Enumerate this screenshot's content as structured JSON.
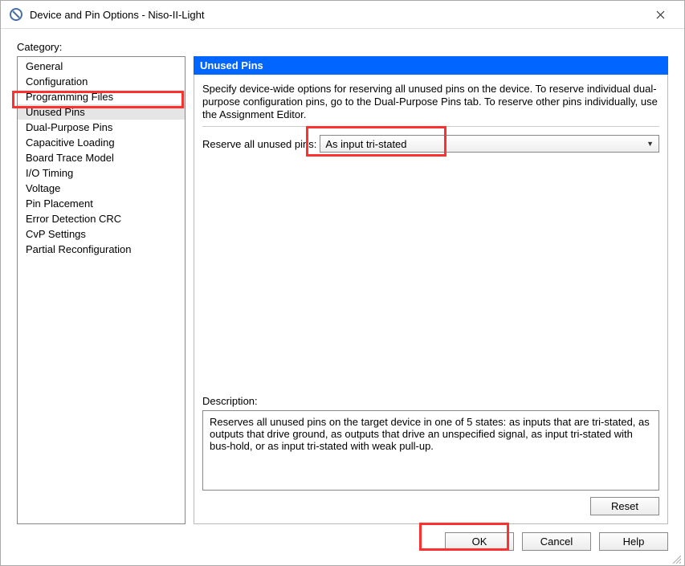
{
  "window": {
    "title": "Device and Pin Options - Niso-II-Light"
  },
  "categoryLabel": "Category:",
  "categories": [
    "General",
    "Configuration",
    "Programming Files",
    "Unused Pins",
    "Dual-Purpose Pins",
    "Capacitive Loading",
    "Board Trace Model",
    "I/O Timing",
    "Voltage",
    "Pin Placement",
    "Error Detection CRC",
    "CvP Settings",
    "Partial Reconfiguration"
  ],
  "selectedCategory": "Unused Pins",
  "panel": {
    "title": "Unused Pins",
    "intro": "Specify device-wide options for reserving all unused pins on the device. To reserve individual dual-purpose configuration pins, go to the Dual-Purpose Pins tab. To reserve other pins individually, use the Assignment Editor.",
    "reserveLabel": "Reserve all unused pins:",
    "reserveValue": "As input tri-stated",
    "descLabel": "Description:",
    "descText": "Reserves all unused pins on the target device in one of 5 states: as inputs that are tri-stated, as outputs that drive ground, as outputs that drive an unspecified signal, as input tri-stated with bus-hold, or as input tri-stated with weak pull-up.",
    "reset": "Reset"
  },
  "buttons": {
    "ok": "OK",
    "cancel": "Cancel",
    "help": "Help"
  }
}
